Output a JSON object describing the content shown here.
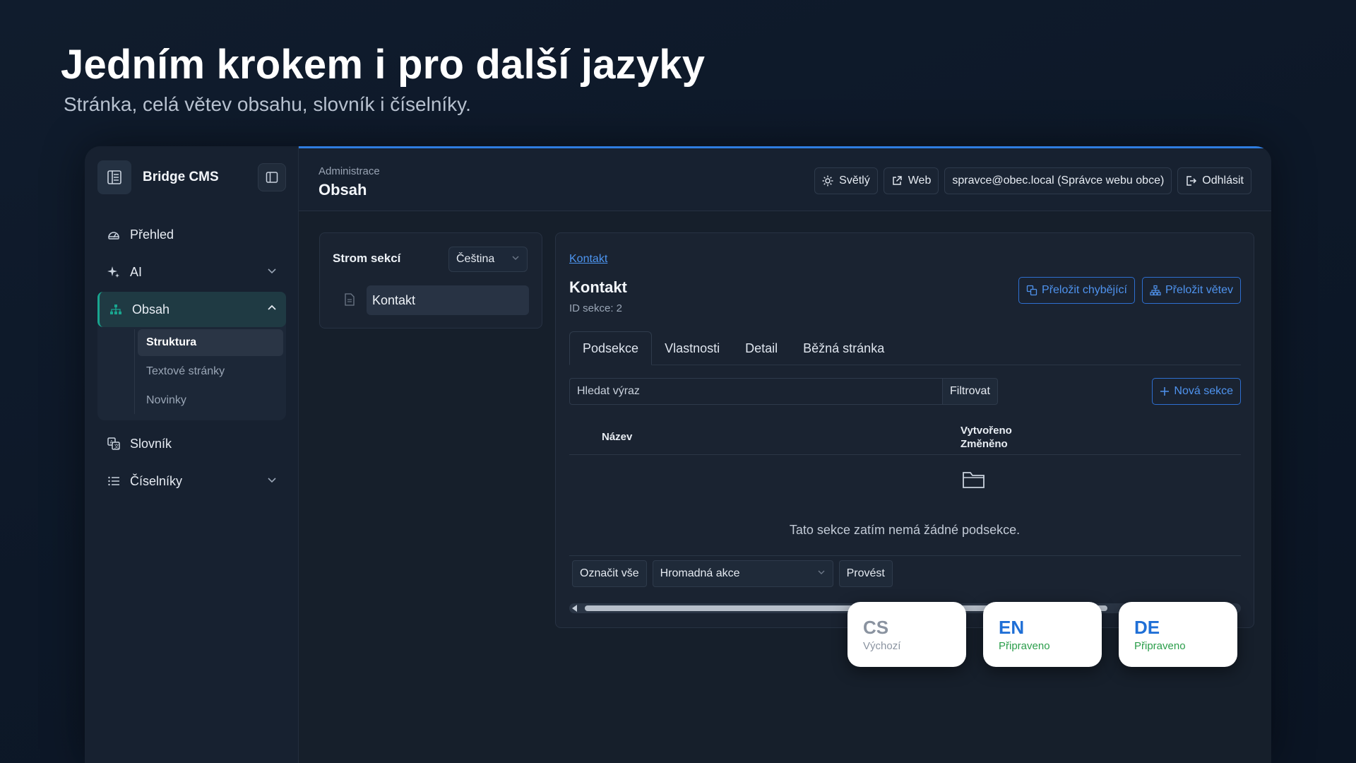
{
  "hero": {
    "title": "Jedním krokem i pro další jazyky",
    "subtitle": "Stránka, celá větev obsahu, slovník i číselníky."
  },
  "sidebar": {
    "brand": "Bridge CMS",
    "items": [
      {
        "label": "Přehled",
        "icon": "dashboard-icon"
      },
      {
        "label": "AI",
        "icon": "sparkle-icon",
        "expandable": true
      },
      {
        "label": "Obsah",
        "icon": "sitemap-icon",
        "active": true,
        "expanded": true,
        "children": [
          {
            "label": "Struktura",
            "active": true
          },
          {
            "label": "Textové stránky"
          },
          {
            "label": "Novinky"
          }
        ]
      },
      {
        "label": "Slovník",
        "icon": "translate-icon"
      },
      {
        "label": "Číselníky",
        "icon": "list-icon",
        "expandable": true
      }
    ]
  },
  "topbar": {
    "breadcrumb_small": "Administrace",
    "breadcrumb_title": "Obsah",
    "theme_label": "Světlý",
    "web_label": "Web",
    "user_label": "spravce@obec.local (Správce webu obce)",
    "logout_label": "Odhlásit"
  },
  "tree": {
    "title": "Strom sekcí",
    "language": "Čeština",
    "node": "Kontakt"
  },
  "content": {
    "breadcrumb_link": "Kontakt",
    "title": "Kontakt",
    "section_id": "ID sekce: 2",
    "translate_missing": "Přeložit chybějící",
    "translate_branch": "Přeložit větev",
    "tabs": [
      "Podsekce",
      "Vlastnosti",
      "Detail",
      "Běžná stránka"
    ],
    "active_tab": "Podsekce",
    "search_placeholder": "Hledat výraz",
    "filter_label": "Filtrovat",
    "new_section_label": "Nová sekce",
    "columns": {
      "name": "Název",
      "created": "Vytvořeno",
      "modified": "Změněno"
    },
    "empty_text": "Tato sekce zatím nemá žádné podsekce.",
    "select_all": "Označit vše",
    "bulk_action": "Hromadná akce",
    "execute": "Provést",
    "scroll_fraction": 0.8
  },
  "languages": [
    {
      "code": "CS",
      "status": "Výchozí",
      "code_color": "#8a93a0",
      "status_color": "#8a93a0"
    },
    {
      "code": "EN",
      "status": "Připraveno",
      "code_color": "#1f6fd6",
      "status_color": "#2a9d4a"
    },
    {
      "code": "DE",
      "status": "Připraveno",
      "code_color": "#1f6fd6",
      "status_color": "#2a9d4a"
    }
  ],
  "colors": {
    "accent": "#2f7de0",
    "active_nav": "#19a58f",
    "link": "#4d95f0"
  }
}
